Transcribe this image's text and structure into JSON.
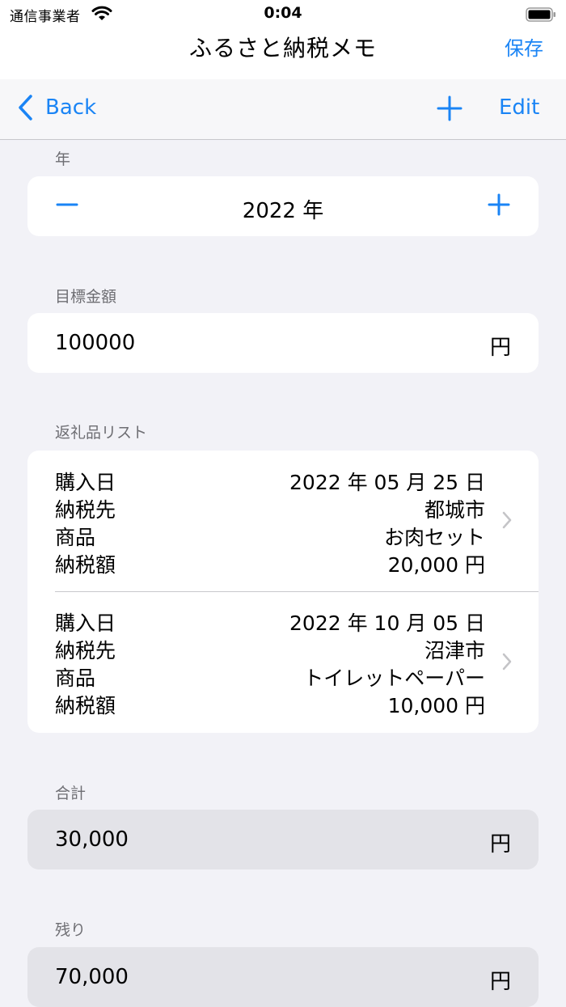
{
  "status_bar": {
    "carrier": "通信事業者",
    "time": "0:04"
  },
  "app": {
    "title": "ふるさと納税メモ",
    "save_label": "保存"
  },
  "nav": {
    "back_label": "Back",
    "edit_label": "Edit"
  },
  "year_section": {
    "label": "年",
    "value": "2022  年"
  },
  "target_section": {
    "label": "目標金額",
    "value": "100000",
    "unit": "円"
  },
  "list_section": {
    "label": "返礼品リスト",
    "items": [
      {
        "date_label": "購入日",
        "date": "2022 年 05 月 25 日",
        "dest_label": "納税先",
        "dest": "都城市",
        "product_label": "商品",
        "product": "お肉セット",
        "amount_label": "納税額",
        "amount": "20,000  円"
      },
      {
        "date_label": "購入日",
        "date": "2022 年 10 月 05 日",
        "dest_label": "納税先",
        "dest": "沼津市",
        "product_label": "商品",
        "product": "トイレットペーパー",
        "amount_label": "納税額",
        "amount": "10,000  円"
      }
    ]
  },
  "total_section": {
    "label": "合計",
    "value": "30,000",
    "unit": "円"
  },
  "remaining_section": {
    "label": "残り",
    "value": "70,000",
    "unit": "円"
  },
  "colors": {
    "accent": "#1a84f5",
    "background": "#f2f2f7",
    "card": "#ffffff",
    "readonly_card": "#e3e3e8"
  }
}
